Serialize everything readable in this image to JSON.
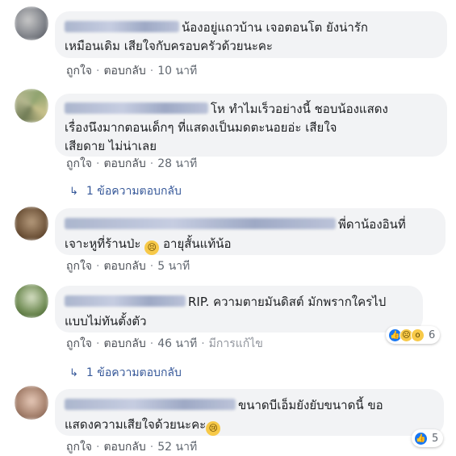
{
  "actions": {
    "like": "ถูกใจ",
    "reply": "ตอบกลับ",
    "dot": "·"
  },
  "comments": [
    {
      "text_line1": "น้องอยู่แถวบ้าน เจอตอนโต ยังน่ารัก",
      "text_line2": "เหมือนเดิม เสียใจกับครอบครัวด้วยนะคะ",
      "time": "10 นาที"
    },
    {
      "text_line1": "โห ทำไมเร็วอย่างนี้ ชอบน้องแสดง",
      "text_line2": "เรื่องนึงมากตอนเด็กๆ ที่แสดงเป็นมดตะนอยอ่ะ เสียใจ",
      "text_line3": "เสียดาย ไม่น่าเลย",
      "time": "28 นาที",
      "replies": "1 ข้อความตอบกลับ"
    },
    {
      "text_line1": "พี่ดาน้องอินที่",
      "text_line2": "เจาะหูที่ร้านป่ะ",
      "emoji": "😣",
      "text_line2b": "อายุสั้นแท้น้อ",
      "time": "5 นาที"
    },
    {
      "text_line1": "RIP. ความตายมันดิสต์ มักพรากใครไป",
      "text_line2": "แบบไม่ทันตั้งตัว",
      "time": "46 นาที",
      "edited": "มีการแก้ไข",
      "reaction_count": "6",
      "replies": "1 ข้อความตอบกลับ"
    },
    {
      "text_line1": "ขนาดบีเอ็มยังยับขนาดนี้ ขอ",
      "text_line2": "แสดงความเสียใจด้วยนะคะ",
      "emoji": "😢",
      "time": "52 นาที",
      "reaction_count": "5"
    }
  ],
  "icons": {
    "reply_arrow": "reply-arrow-icon",
    "like": "like-reaction-icon",
    "sad": "sad-reaction-icon",
    "wow": "wow-reaction-icon"
  },
  "colors": {
    "bubble": "#f2f3f5",
    "link": "#365899",
    "meta": "#606770"
  }
}
